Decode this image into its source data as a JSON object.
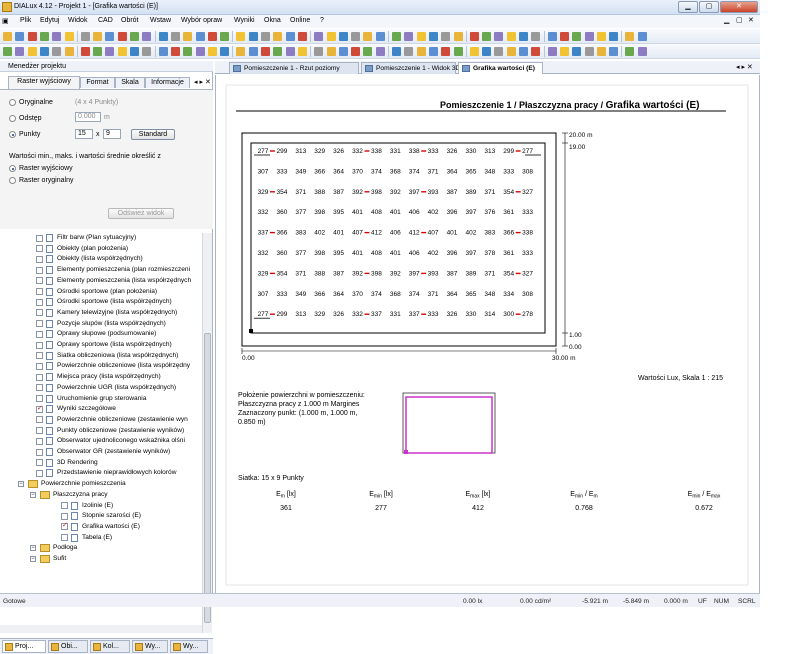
{
  "window": {
    "title": "DIALux 4.12 - Projekt 1 - [Grafika wartości (E)]",
    "min": "▁",
    "max": "▢",
    "close": "✕"
  },
  "menu": [
    "Plik",
    "Edytuj",
    "Widok",
    "CAD",
    "Obrót",
    "Wstaw",
    "Wybór opraw",
    "Wyniki",
    "Okna",
    "Online",
    "?"
  ],
  "mdi": [
    "▁",
    "▢",
    "✕"
  ],
  "left": {
    "title": "Menedżer projektu",
    "tabs": [
      "Raster wyjściowy",
      "Format",
      "Skala",
      "Informacje"
    ],
    "tab_arrows": "◂ ▸",
    "close": "✕",
    "radios": {
      "orig": "Oryginalne",
      "orig_hint": "(4 x 4 Punkty)",
      "odstep": "Odstęp",
      "odstep_val": "0.000",
      "odstep_unit": "m",
      "punkty": "Punkty",
      "px": "15",
      "x": "x",
      "py": "9",
      "standard": "Standard"
    },
    "minmax_label": "Wartości min., maks. i wartości średnie określić z",
    "r1": "Raster wyjściowy",
    "r2": "Raster oryginalny",
    "refresh": "Odśwież widok",
    "tree": [
      {
        "t": "Filtr barw (Plan sytuacyjny)",
        "lvl": 2,
        "cb": false
      },
      {
        "t": "Obiekty (plan położenia)",
        "lvl": 2,
        "cb": false
      },
      {
        "t": "Obiekty (lista współrzędnych)",
        "lvl": 2,
        "cb": false
      },
      {
        "t": "Elementy pomieszczenia (plan rozmieszczeni",
        "lvl": 2,
        "cb": false
      },
      {
        "t": "Elementy pomieszczenia (lista współrzędnych",
        "lvl": 2,
        "cb": false
      },
      {
        "t": "Ośrodki sportowe (plan położenia)",
        "lvl": 2,
        "cb": false
      },
      {
        "t": "Ośrodki sportowe (lista współrzędnych)",
        "lvl": 2,
        "cb": false
      },
      {
        "t": "Kamery telewizyjne (lista współrzędnych)",
        "lvl": 2,
        "cb": false
      },
      {
        "t": "Pozycje słupów (lista współrzędnych)",
        "lvl": 2,
        "cb": false
      },
      {
        "t": "Oprawy słupowe (podsumowanie)",
        "lvl": 2,
        "cb": false
      },
      {
        "t": "Oprawy sportowe (lista współrzędnych)",
        "lvl": 2,
        "cb": false
      },
      {
        "t": "Siatka obliczeniowa (lista współrzędnych)",
        "lvl": 2,
        "cb": false
      },
      {
        "t": "Powierzchnie obliczeniowe (lista współrzędny",
        "lvl": 2,
        "cb": false
      },
      {
        "t": "Miejsca pracy (lista współrzędnych)",
        "lvl": 2,
        "cb": false
      },
      {
        "t": "Powierzchnie UGR (lista współrzędnych)",
        "lvl": 2,
        "cb": false
      },
      {
        "t": "Uruchomienie grup sterowania",
        "lvl": 2,
        "cb": false
      },
      {
        "t": "Wyniki szczegółowe",
        "lvl": 2,
        "cb": true
      },
      {
        "t": "Powierzchnie obliczeniowe (zestawienie wyn",
        "lvl": 2,
        "cb": false
      },
      {
        "t": "Punkty obliczeniowe (zestawienie wyników)",
        "lvl": 2,
        "cb": false
      },
      {
        "t": "Obserwator ujednoliconego wskaźnika olśni",
        "lvl": 2,
        "cb": false
      },
      {
        "t": "Obserwator GR (zestawienie wyników)",
        "lvl": 2,
        "cb": false
      },
      {
        "t": "3D Rendering",
        "lvl": 2,
        "cb": false
      },
      {
        "t": "Przedstawienie nieprawidłowych kolorów",
        "lvl": 2,
        "cb": false
      },
      {
        "t": "Powierzchnie pomieszczenia",
        "lvl": 1,
        "folder": true
      },
      {
        "t": "Płaszczyzna pracy",
        "lvl": 2,
        "folder": true
      },
      {
        "t": "Izolinie (E)",
        "lvl": 3,
        "cb": false
      },
      {
        "t": "Stopnie szarości (E)",
        "lvl": 3,
        "cb": false
      },
      {
        "t": "Grafika wartości (E)",
        "lvl": 3,
        "cb": true
      },
      {
        "t": "Tabela (E)",
        "lvl": 3,
        "cb": false
      },
      {
        "t": "Podłoga",
        "lvl": 2,
        "folder": true
      },
      {
        "t": "Sufit",
        "lvl": 2,
        "folder": true
      }
    ],
    "bottom_tabs": [
      "Proj...",
      "Obi...",
      "Kol...",
      "Wy...",
      "Wy..."
    ]
  },
  "doc": {
    "tabs": [
      "Pomieszczenie 1 - Rzut poziomy",
      "Pomieszczenie 1 - Widok 3D",
      "Grafika wartości (E)"
    ],
    "arrows": "◂ ▸ ✕",
    "header_prefix": "Pomieszczenie 1 / Płaszczyzna pracy / ",
    "header_bold": "Grafika wartości (E)",
    "grid": [
      [
        277,
        299,
        313,
        329,
        326,
        332,
        338,
        331,
        338,
        333,
        326,
        330,
        313,
        299,
        277
      ],
      [
        307,
        333,
        349,
        366,
        364,
        370,
        374,
        368,
        374,
        371,
        364,
        365,
        348,
        333,
        308
      ],
      [
        329,
        354,
        371,
        388,
        387,
        392,
        398,
        392,
        397,
        393,
        387,
        389,
        371,
        354,
        327
      ],
      [
        332,
        360,
        377,
        398,
        395,
        401,
        408,
        401,
        406,
        402,
        396,
        397,
        376,
        361,
        333
      ],
      [
        337,
        366,
        383,
        402,
        401,
        407,
        412,
        406,
        412,
        407,
        401,
        402,
        383,
        366,
        338
      ],
      [
        332,
        360,
        377,
        398,
        395,
        401,
        408,
        401,
        406,
        402,
        396,
        397,
        378,
        361,
        333
      ],
      [
        329,
        354,
        371,
        388,
        387,
        392,
        398,
        392,
        397,
        393,
        387,
        389,
        371,
        354,
        327
      ],
      [
        307,
        333,
        349,
        366,
        364,
        370,
        374,
        368,
        374,
        371,
        364,
        365,
        348,
        334,
        308
      ],
      [
        277,
        299,
        313,
        329,
        326,
        332,
        337,
        331,
        337,
        333,
        326,
        330,
        314,
        300,
        278
      ]
    ],
    "axis_top": "20.00 m",
    "axis_y2": "19.00",
    "axis_y3": "1.00",
    "axis_y4": "0.00",
    "axis_x0": "0.00",
    "axis_x1": "30.00 m",
    "scale": "Wartości Lux, Skala 1 : 215",
    "pos_text": "Położenie powierzchni w pomieszczeniu: Płaszczyzna pracy z 1.000 m Margines Zaznaczony punkt: (1.000 m, 1.000 m, 0.850 m)",
    "siatka": "Siatka: 15 x 9 Punkty",
    "cols": [
      "Em [lx]",
      "Emin [lx]",
      "Emax [lx]",
      "Emin / Em",
      "Emin / Emax"
    ],
    "vals": [
      "361",
      "277",
      "412",
      "0.768",
      "0.672"
    ]
  },
  "status": {
    "ready": "Gotowe",
    "lx": "0.00 lx",
    "cd": "0.00 cd/m²",
    "c1": "-5.921 m",
    "c2": "-5.849 m",
    "c3": "0.000 m",
    "uf": "UF",
    "num": "NUM",
    "scrl": "SCRL"
  }
}
